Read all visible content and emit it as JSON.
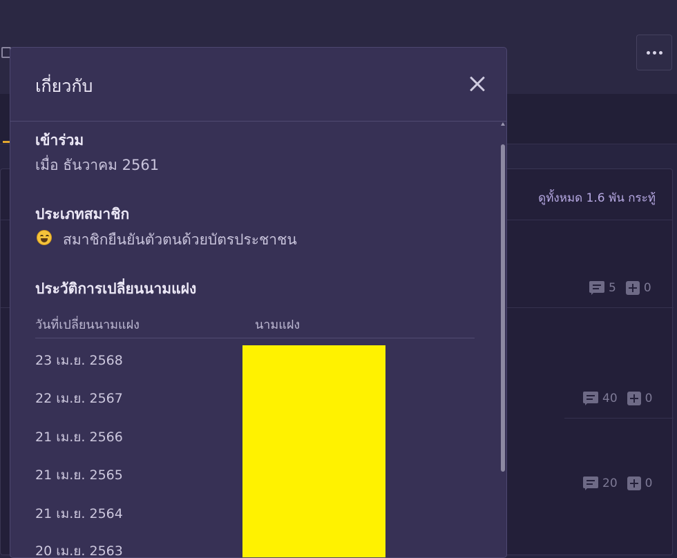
{
  "background": {
    "view_all_label": "ดูทั้งหมด 1.6 พัน กระทู้",
    "stats": [
      {
        "comments": "5",
        "plus": "0"
      },
      {
        "comments": "40",
        "plus": "0"
      },
      {
        "comments": "20",
        "plus": "0"
      }
    ]
  },
  "modal": {
    "title": "เกี่ยวกับ",
    "joined": {
      "label": "เข้าร่วม",
      "value": "เมื่อ ธันวาคม 2561"
    },
    "member_type": {
      "label": "ประเภทสมาชิก",
      "value": "สมาชิกยืนยันตัวตนด้วยบัตรประชาชน"
    },
    "alias_history": {
      "label": "ประวัติการเปลี่ยนนามแฝง",
      "columns": [
        "วันที่เปลี่ยนนามแฝง",
        "นามแฝง"
      ],
      "rows": [
        {
          "date": "23 เม.ย. 2568"
        },
        {
          "date": "22 เม.ย. 2567"
        },
        {
          "date": "21 เม.ย. 2566"
        },
        {
          "date": "21 เม.ย. 2565"
        },
        {
          "date": "21 เม.ย. 2564"
        },
        {
          "date": "20 เม.ย. 2563"
        }
      ]
    }
  },
  "colors": {
    "redaction": "#fff200",
    "accent_tab": "#e2a72e",
    "link": "#b7a9e3"
  }
}
